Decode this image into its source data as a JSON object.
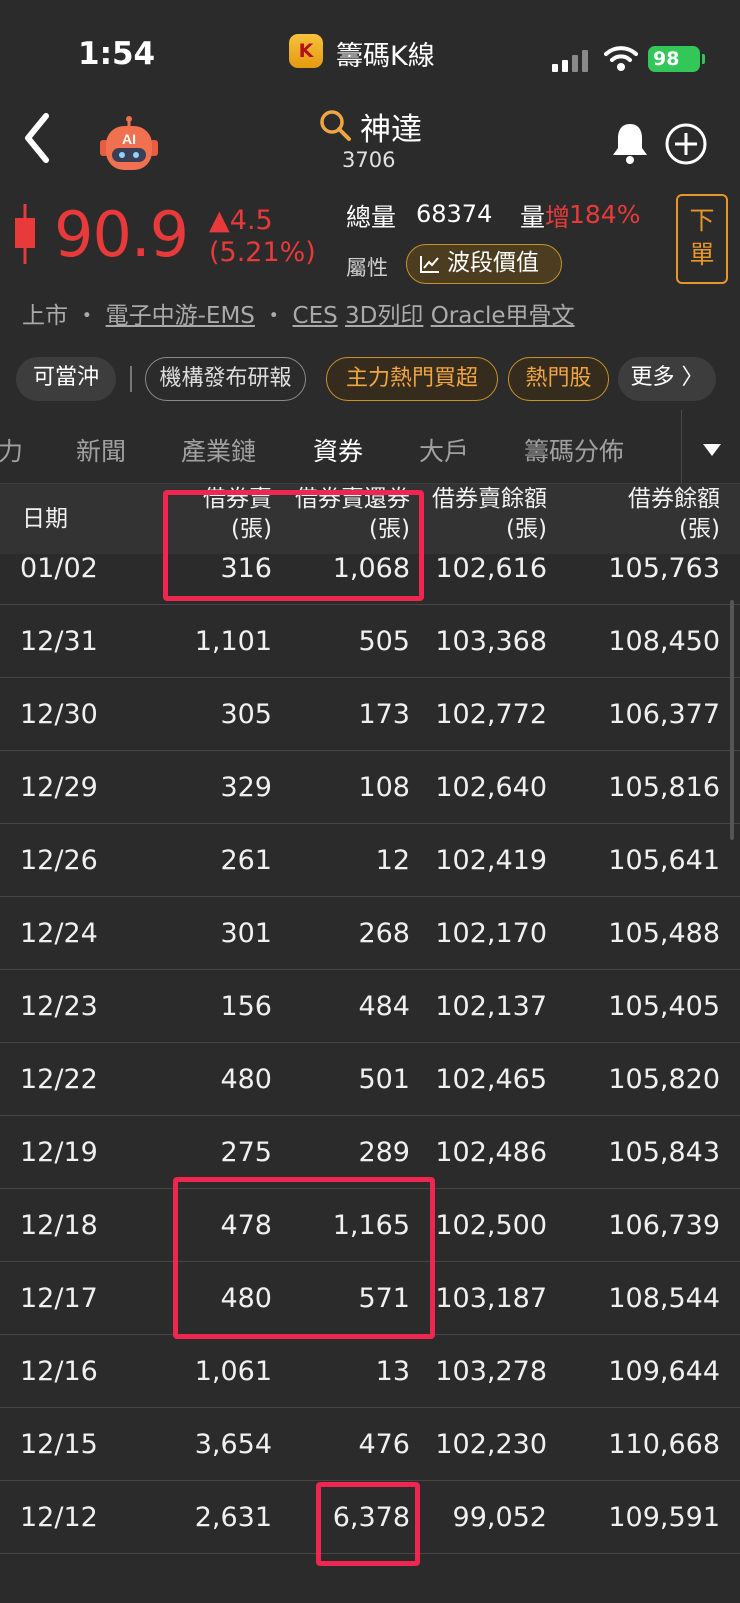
{
  "status_bar": {
    "time": "1:54",
    "app_badge": "K",
    "app_name": "籌碼K線",
    "battery": "98"
  },
  "header": {
    "stock_name": "神達",
    "stock_code": "3706",
    "ai_label": "AI"
  },
  "quote": {
    "price": "90.9",
    "change": "▲4.5",
    "change_pct": "(5.21%)",
    "volume_label": "總量",
    "volume_value": "68374",
    "volume_inc_label": "量",
    "volume_inc_word": "增",
    "volume_inc_pct": "184%",
    "attr_label": "屬性",
    "attr_chip": "波段價值",
    "order_button": [
      "下",
      "單"
    ]
  },
  "tags": {
    "market": "上市",
    "sep": "・",
    "industry": "電子中游-EMS",
    "t1": "CES",
    "t2": "3D列印",
    "t3": "Oracle甲骨文"
  },
  "chips": [
    "可當沖",
    "機構發布研報",
    "主力熱門買超",
    "熱門股",
    "更多 〉"
  ],
  "tabs": [
    "力",
    "新聞",
    "產業鏈",
    "資券",
    "大戶",
    "籌碼分佈"
  ],
  "table": {
    "headers": [
      {
        "l1": "日期",
        "l2": ""
      },
      {
        "l1": "借券賣",
        "l2": "(張)"
      },
      {
        "l1": "借券賣還券",
        "l2": "(張)"
      },
      {
        "l1": "借券賣餘額",
        "l2": "(張)"
      },
      {
        "l1": "借券餘額",
        "l2": "(張)"
      }
    ],
    "rows": [
      [
        "01/02",
        "316",
        "1,068",
        "102,616",
        "105,763"
      ],
      [
        "12/31",
        "1,101",
        "505",
        "103,368",
        "108,450"
      ],
      [
        "12/30",
        "305",
        "173",
        "102,772",
        "106,377"
      ],
      [
        "12/29",
        "329",
        "108",
        "102,640",
        "105,816"
      ],
      [
        "12/26",
        "261",
        "12",
        "102,419",
        "105,641"
      ],
      [
        "12/24",
        "301",
        "268",
        "102,170",
        "105,488"
      ],
      [
        "12/23",
        "156",
        "484",
        "102,137",
        "105,405"
      ],
      [
        "12/22",
        "480",
        "501",
        "102,465",
        "105,820"
      ],
      [
        "12/19",
        "275",
        "289",
        "102,486",
        "105,843"
      ],
      [
        "12/18",
        "478",
        "1,165",
        "102,500",
        "106,739"
      ],
      [
        "12/17",
        "480",
        "571",
        "103,187",
        "108,544"
      ],
      [
        "12/16",
        "1,061",
        "13",
        "103,278",
        "109,644"
      ],
      [
        "12/15",
        "3,654",
        "476",
        "102,230",
        "110,668"
      ],
      [
        "12/12",
        "2,631",
        "6,378",
        "99,052",
        "109,591"
      ]
    ]
  },
  "colors": {
    "up": "#e83a3a",
    "accent": "#e8962a",
    "highlight": "#ee2650"
  }
}
